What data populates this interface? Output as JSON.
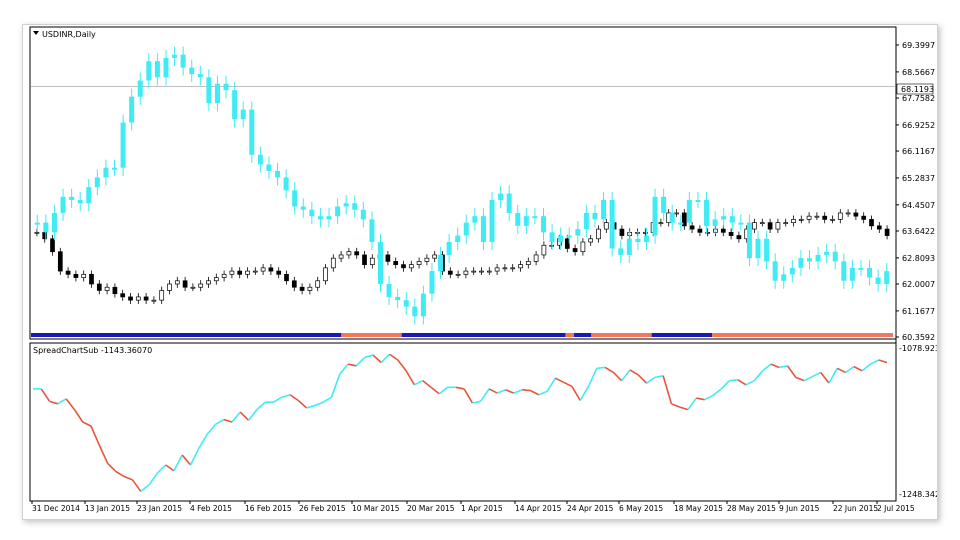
{
  "main_chart": {
    "title": "USDINR,Daily",
    "current_price": "68.1193",
    "price_labels": [
      "69.3997",
      "68.5667",
      "67.7582",
      "66.9252",
      "66.1167",
      "65.2837",
      "64.4507",
      "63.6422",
      "62.8093",
      "62.0007",
      "61.1677",
      "60.3592"
    ]
  },
  "sub_chart": {
    "title": "SpreadChartSub -1143.36070",
    "top_label": "-1078.923",
    "bottom_label": "-1248.342"
  },
  "time_labels": [
    "31 Dec 2014",
    "13 Jan 2015",
    "23 Jan 2015",
    "4 Feb 2015",
    "16 Feb 2015",
    "26 Feb 2015",
    "10 Mar 2015",
    "20 Mar 2015",
    "1 Apr 2015",
    "14 Apr 2015",
    "24 Apr 2015",
    "6 May 2015",
    "18 May 2015",
    "28 May 2015",
    "9 Jun 2015",
    "22 Jun 2015",
    "2 Jul 2015"
  ],
  "colors": {
    "bull": "#ffffff",
    "bear": "#000000",
    "aqua": "#40ecf4",
    "red": "#e8553c",
    "blue": "#1a1ab0",
    "salmon": "#f07860",
    "grid": "#aaaaaa"
  },
  "chart_data": {
    "type": "candlestick",
    "series": [
      {
        "name": "USDINR",
        "close": [
          63.6,
          63.4,
          63.0,
          62.4,
          62.3,
          62.2,
          62.3,
          62.0,
          61.8,
          61.9,
          61.7,
          61.6,
          61.5,
          61.6,
          61.5,
          61.5,
          61.8,
          62.0,
          62.1,
          61.9,
          61.9,
          62.0,
          62.1,
          62.2,
          62.3,
          62.4,
          62.3,
          62.4,
          62.4,
          62.5,
          62.4,
          62.3,
          62.1,
          61.9,
          61.8,
          61.9,
          62.1,
          62.5,
          62.8,
          62.9,
          63.0,
          62.9,
          62.6,
          62.8,
          62.9,
          62.7,
          62.6,
          62.5,
          62.6,
          62.7,
          62.8,
          62.9,
          62.4,
          62.3,
          62.3,
          62.4,
          62.4,
          62.4,
          62.4,
          62.5,
          62.5,
          62.5,
          62.6,
          62.7,
          62.9,
          63.2,
          63.2,
          63.4,
          63.1,
          63.0,
          63.3,
          63.4,
          63.7,
          63.9,
          63.7,
          63.5,
          63.6,
          63.6,
          63.6,
          63.9,
          63.9,
          64.2,
          64.2,
          63.8,
          63.7,
          63.6,
          63.6,
          63.7,
          63.6,
          63.5,
          63.4,
          63.7,
          63.9,
          63.9,
          63.7,
          63.9,
          63.9,
          64.0,
          64.0,
          64.1,
          64.1,
          64.0,
          64.0,
          64.2,
          64.2,
          64.1,
          64.0,
          63.8,
          63.7,
          63.5
        ],
        "aqua_line": [
          63.9,
          63.6,
          64.2,
          64.7,
          64.6,
          64.5,
          65.0,
          65.3,
          65.6,
          65.6,
          67.0,
          67.8,
          68.3,
          68.9,
          68.4,
          69.0,
          69.1,
          68.7,
          68.5,
          68.4,
          67.6,
          68.2,
          68.0,
          67.1,
          67.4,
          66.0,
          65.7,
          65.5,
          65.3,
          64.9,
          64.4,
          64.3,
          64.1,
          64.0,
          64.1,
          64.4,
          64.5,
          64.3,
          64.0,
          63.3,
          62.0,
          61.6,
          61.5,
          61.3,
          61.0,
          61.7,
          62.4,
          62.9,
          63.3,
          63.5,
          63.9,
          64.1,
          63.3,
          64.6,
          64.8,
          64.2,
          63.8,
          64.1,
          64.1,
          63.6,
          63.3,
          63.5,
          63.5,
          63.7,
          64.2,
          64.0,
          64.6,
          63.1,
          62.9,
          63.4,
          63.3,
          63.5,
          64.7,
          64.2,
          63.9,
          63.9,
          64.6,
          64.6,
          63.8,
          64.0,
          64.1,
          63.9,
          63.9,
          62.8,
          63.4,
          62.7,
          62.1,
          62.3,
          62.5,
          62.8,
          62.7,
          62.9,
          63.0,
          62.7,
          62.1,
          62.5,
          62.5,
          62.2,
          62.0,
          62.4
        ]
      },
      {
        "name": "SpreadChartSub",
        "values": [
          -1120,
          -1120,
          -1135,
          -1138,
          -1132,
          -1145,
          -1160,
          -1165,
          -1188,
          -1210,
          -1220,
          -1226,
          -1230,
          -1244,
          -1236,
          -1222,
          -1212,
          -1219,
          -1200,
          -1212,
          -1192,
          -1175,
          -1163,
          -1157,
          -1160,
          -1148,
          -1158,
          -1145,
          -1136,
          -1136,
          -1130,
          -1127,
          -1134,
          -1143,
          -1140,
          -1136,
          -1130,
          -1102,
          -1090,
          -1092,
          -1082,
          -1079,
          -1088,
          -1078,
          -1085,
          -1098,
          -1115,
          -1110,
          -1118,
          -1126,
          -1118,
          -1118,
          -1120,
          -1137,
          -1135,
          -1120,
          -1125,
          -1121,
          -1125,
          -1121,
          -1122,
          -1127,
          -1123,
          -1107,
          -1112,
          -1117,
          -1134,
          -1117,
          -1095,
          -1094,
          -1100,
          -1110,
          -1097,
          -1103,
          -1113,
          -1106,
          -1104,
          -1138,
          -1142,
          -1145,
          -1131,
          -1133,
          -1128,
          -1120,
          -1110,
          -1109,
          -1115,
          -1110,
          -1098,
          -1090,
          -1094,
          -1092,
          -1106,
          -1110,
          -1105,
          -1100,
          -1113,
          -1095,
          -1100,
          -1093,
          -1098,
          -1090,
          -1085,
          -1088
        ]
      }
    ],
    "ylim_main": [
      60.3592,
      69.3997
    ],
    "ylim_sub": [
      -1248.342,
      -1078.923
    ],
    "horizontal_line": 68.1193
  }
}
